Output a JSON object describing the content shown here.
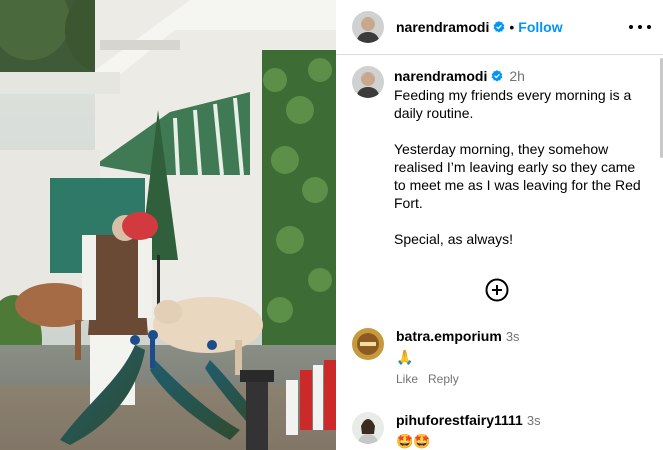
{
  "post": {
    "username": "narendramodi",
    "follow_label": "Follow",
    "separator": "•",
    "caption": {
      "username": "narendramodi",
      "time": "2h",
      "text": "Feeding my friends every morning is a daily routine.\n\nYesterday morning, they somehow realised I’m leaving early so they came to meet me as I was leaving for the Red Fort.\n\nSpecial, as always!"
    }
  },
  "comments": [
    {
      "username": "batra.emporium",
      "time": "3s",
      "text": "🙏",
      "like_label": "Like",
      "reply_label": "Reply"
    },
    {
      "username": "pihuforestfairy1111",
      "time": "3s",
      "text": "🤩🤩"
    }
  ],
  "colors": {
    "accent": "#0095f6",
    "verified": "#0095f6",
    "muted": "#737373"
  },
  "icons": [
    "verified-badge-icon",
    "more-options-icon",
    "add-circle-icon",
    "folded-hands-emoji",
    "star-struck-emoji"
  ]
}
